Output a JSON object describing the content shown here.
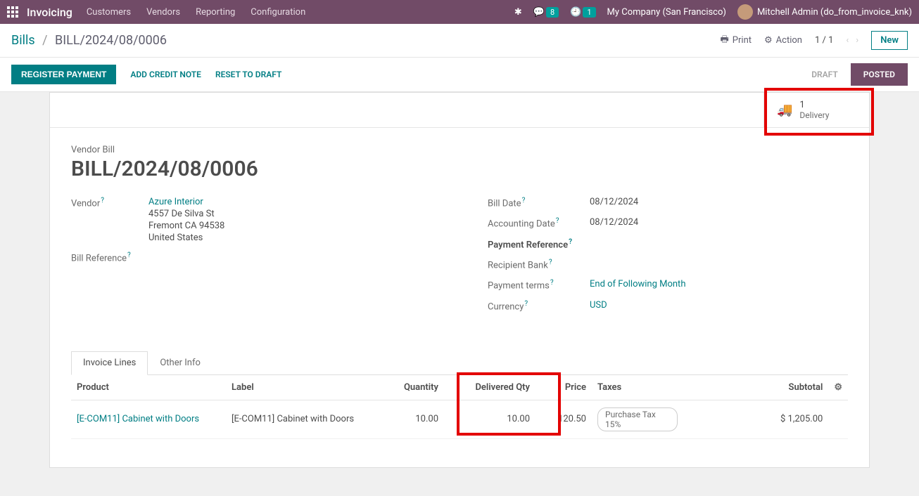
{
  "nav": {
    "brand": "Invoicing",
    "menu": [
      "Customers",
      "Vendors",
      "Reporting",
      "Configuration"
    ],
    "chat_badge": "8",
    "clock_badge": "1",
    "company": "My Company (San Francisco)",
    "user": "Mitchell Admin (do_from_invoice_knk)"
  },
  "subheader": {
    "breadcrumb_root": "Bills",
    "breadcrumb_current": "BILL/2024/08/0006",
    "print": "Print",
    "action": "Action",
    "pager": "1 / 1",
    "new_btn": "New"
  },
  "actionbar": {
    "register_payment": "REGISTER PAYMENT",
    "add_credit_note": "ADD CREDIT NOTE",
    "reset_to_draft": "RESET TO DRAFT",
    "status_draft": "DRAFT",
    "status_posted": "POSTED"
  },
  "stat": {
    "count": "1",
    "label": "Delivery"
  },
  "form": {
    "pretitle": "Vendor Bill",
    "title": "BILL/2024/08/0006",
    "vendor_label": "Vendor",
    "vendor_name": "Azure Interior",
    "vendor_addr1": "4557 De Silva St",
    "vendor_addr2": "Fremont CA 94538",
    "vendor_addr3": "United States",
    "bill_ref_label": "Bill Reference",
    "bill_date_label": "Bill Date",
    "bill_date": "08/12/2024",
    "acct_date_label": "Accounting Date",
    "acct_date": "08/12/2024",
    "pay_ref_label": "Payment Reference",
    "recip_bank_label": "Recipient Bank",
    "pay_terms_label": "Payment terms",
    "pay_terms": "End of Following Month",
    "currency_label": "Currency",
    "currency": "USD"
  },
  "tabs": {
    "invoice_lines": "Invoice Lines",
    "other_info": "Other Info"
  },
  "table": {
    "headers": {
      "product": "Product",
      "label": "Label",
      "quantity": "Quantity",
      "delivered": "Delivered Qty",
      "price": "Price",
      "taxes": "Taxes",
      "subtotal": "Subtotal"
    },
    "row": {
      "product": "[E-COM11] Cabinet with Doors",
      "label": "[E-COM11] Cabinet with Doors",
      "quantity": "10.00",
      "delivered": "10.00",
      "price": "120.50",
      "tax": "Purchase Tax 15%",
      "subtotal": "$ 1,205.00"
    }
  }
}
